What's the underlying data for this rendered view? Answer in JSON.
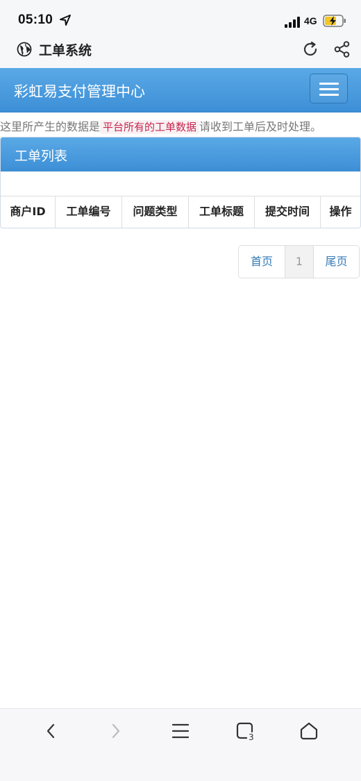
{
  "status": {
    "time": "05:10",
    "network": "4G",
    "icons": [
      "location-arrow-icon",
      "signal-icon",
      "battery-charging-icon"
    ]
  },
  "browser": {
    "title": "工单系统",
    "icons": [
      "globe-icon",
      "reload-icon",
      "share-icon"
    ]
  },
  "navbar": {
    "brand": "彩虹易支付管理中心",
    "toggle_icon": "hamburger-menu-icon"
  },
  "note": {
    "prefix": "这里所产生的数据是",
    "highlight": "平台所有的工单数据",
    "suffix": "请收到工单后及时处理。"
  },
  "panel": {
    "title": "工单列表",
    "columns": [
      "商户ID",
      "工单编号",
      "问题类型",
      "工单标题",
      "提交时间",
      "操作"
    ],
    "rows": []
  },
  "pagination": {
    "first": "首页",
    "current": "1",
    "last": "尾页"
  },
  "bottom_nav": {
    "icons": [
      "back-icon",
      "forward-icon",
      "menu-icon",
      "tabs-icon",
      "home-icon"
    ],
    "tab_count": "3"
  },
  "colors": {
    "primary": "#3d8fd6",
    "highlight_text": "#c7254e",
    "link": "#337ab7"
  }
}
